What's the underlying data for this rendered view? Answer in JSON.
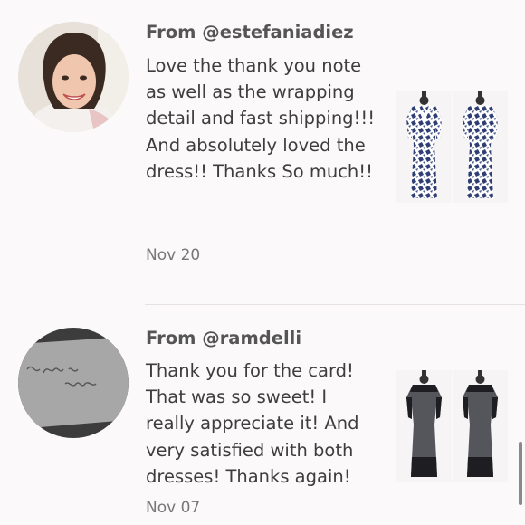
{
  "reviews": [
    {
      "from": "From @estefaniadiez",
      "message": "Love the thank you note as well as the wrapping detail and fast shipping!!! And absolutely loved the dress!! Thanks So much!!",
      "date": "Nov 20",
      "product": "blue-white-print-dress",
      "colors": {
        "print": "#2f3f73",
        "background": "#ffffff"
      }
    },
    {
      "from": "From @ramdelli",
      "message": "Thank you for the card! That was so sweet! I really appreciate it! And very satisfied with both dresses! Thanks again!",
      "date": "Nov 07",
      "avatar_note": "i love you So much",
      "product": "grey-black-sheath-dress",
      "colors": {
        "body": "#55565c",
        "accent": "#1e1e22"
      }
    }
  ]
}
